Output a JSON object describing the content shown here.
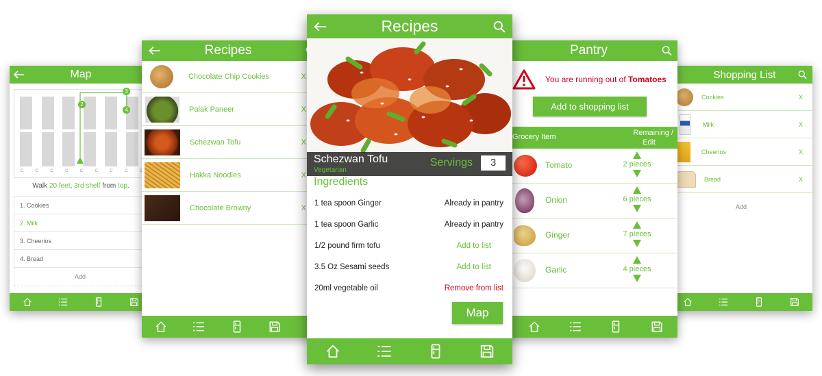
{
  "map": {
    "title": "Map",
    "pins": [
      "2",
      "3",
      "4"
    ],
    "shelf_letters": [
      "C",
      "C",
      "C",
      "C",
      "C",
      "C",
      "C",
      "C",
      "C"
    ],
    "walk_prefix": "Walk ",
    "walk_feet": "20 feet",
    "walk_mid1": ", ",
    "walk_shelf": "3rd shelf",
    "walk_mid2": " from ",
    "walk_top": "top",
    "walk_end": ".",
    "items": [
      "1. Cookies",
      "2. Milk",
      "3. Cheerios",
      "4. Bread"
    ],
    "remove": "X",
    "add": "Add"
  },
  "recipes": {
    "title": "Recipes",
    "items": [
      "Chocolate Chip Cookies",
      "Palak Paneer",
      "Schezwan Tofu",
      "Hakka Noodles",
      "Chocolate Browny"
    ],
    "remove": "X"
  },
  "detail": {
    "title": "Recipes",
    "dish": "Schezwan Tofu",
    "diet": "Vegetarian",
    "servings_label": "Servings",
    "servings_value": "3",
    "ingredients_title": "Ingredients",
    "ingredients": [
      {
        "name": "1 tea spoon Ginger",
        "status": "Already in pantry"
      },
      {
        "name": "1 tea spoon Garlic",
        "status": "Already in pantry"
      },
      {
        "name": "1/2 pound firm tofu",
        "status": "Add to list"
      },
      {
        "name": "3.5 Oz Sesami seeds",
        "status": "Add to list"
      },
      {
        "name": "20ml vegetable oil",
        "status": "Remove from list"
      }
    ],
    "map_button": "Map"
  },
  "pantry": {
    "title": "Pantry",
    "alert_prefix": "You are running out of ",
    "alert_item": "Tomatoes",
    "add_button": "Add to shopping list",
    "col_item": "Grocery Item",
    "col_remaining": "Remaining /",
    "col_edit": "Edit",
    "items": [
      {
        "name": "Tomato",
        "qty": "2 pieces"
      },
      {
        "name": "Onion",
        "qty": "6 pieces"
      },
      {
        "name": "Ginger",
        "qty": "7 pieces"
      },
      {
        "name": "Garlic",
        "qty": "4 pieces"
      }
    ]
  },
  "shopping": {
    "title": "Shopping List",
    "items": [
      "Cookies",
      "Milk",
      "Cheerios",
      "Bread"
    ],
    "remove": "X",
    "add": "Add"
  },
  "colors": {
    "accent": "#6abf3a",
    "alert": "#d0021b"
  }
}
